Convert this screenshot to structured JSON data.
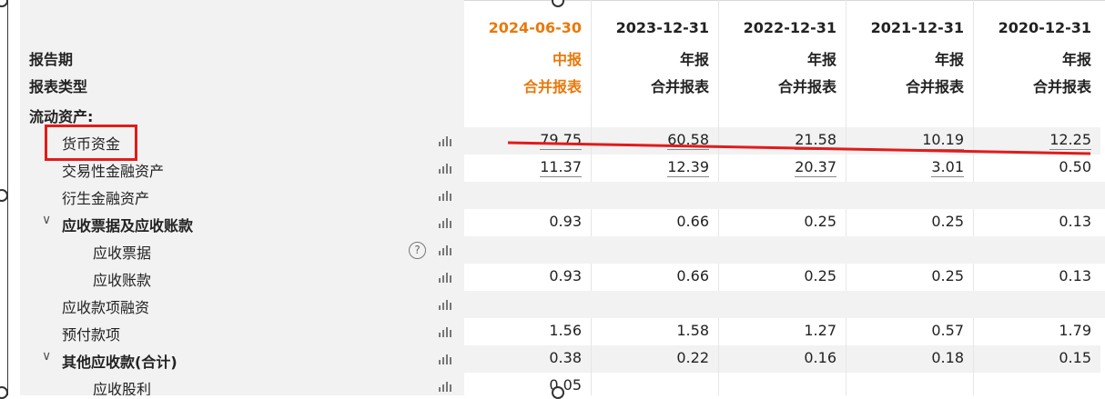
{
  "header": {
    "report_period_label": "报告期",
    "report_type_label": "报表类型",
    "columns": [
      {
        "date": "2024-06-30",
        "period": "中报",
        "type": "合并报表"
      },
      {
        "date": "2023-12-31",
        "period": "年报",
        "type": "合并报表"
      },
      {
        "date": "2022-12-31",
        "period": "年报",
        "type": "合并报表"
      },
      {
        "date": "2021-12-31",
        "period": "年报",
        "type": "合并报表"
      },
      {
        "date": "2020-12-31",
        "period": "年报",
        "type": "合并报表"
      }
    ]
  },
  "section_title": "流动资产:",
  "rows": [
    {
      "label": "货币资金",
      "values": [
        "79.75",
        "60.58",
        "21.58",
        "10.19",
        "12.25"
      ]
    },
    {
      "label": "交易性金融资产",
      "values": [
        "11.37",
        "12.39",
        "20.37",
        "3.01",
        "0.50"
      ]
    },
    {
      "label": "衍生金融资产",
      "values": [
        "",
        "",
        "",
        "",
        ""
      ]
    },
    {
      "label": "应收票据及应收账款",
      "values": [
        "0.93",
        "0.66",
        "0.25",
        "0.25",
        "0.13"
      ]
    },
    {
      "label": "应收票据",
      "values": [
        "",
        "",
        "",
        "",
        ""
      ]
    },
    {
      "label": "应收账款",
      "values": [
        "0.93",
        "0.66",
        "0.25",
        "0.25",
        "0.13"
      ]
    },
    {
      "label": "应收款项融资",
      "values": [
        "",
        "",
        "",
        "",
        ""
      ]
    },
    {
      "label": "预付款项",
      "values": [
        "1.56",
        "1.58",
        "1.27",
        "0.57",
        "1.79"
      ]
    },
    {
      "label": "其他应收款(合计)",
      "values": [
        "0.38",
        "0.22",
        "0.16",
        "0.18",
        "0.15"
      ]
    },
    {
      "label": "应收股利",
      "values": [
        "0.05",
        "",
        "",
        "",
        ""
      ]
    }
  ],
  "colors": {
    "highlight": "#e8790b",
    "annotation": "#e21b1b",
    "shade": "#f2f2f2"
  }
}
